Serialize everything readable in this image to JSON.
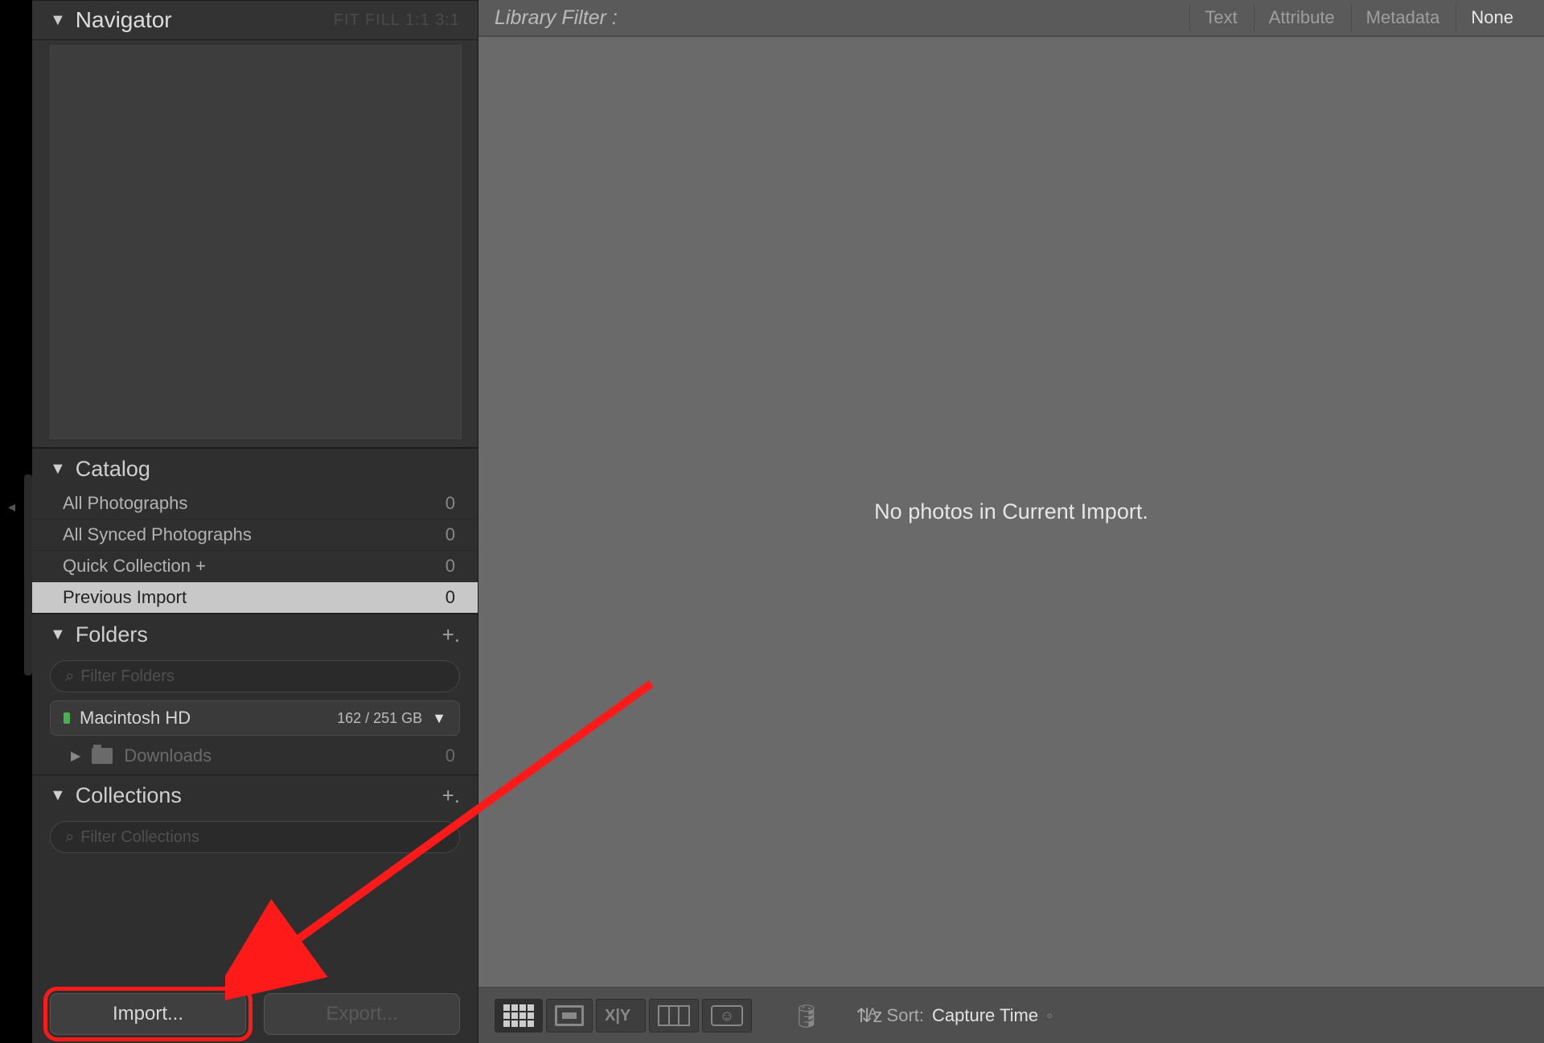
{
  "sidebar": {
    "navigator": {
      "title": "Navigator",
      "zoom_levels": "FIT  FILL   1:1   3:1"
    },
    "catalog": {
      "title": "Catalog",
      "items": [
        {
          "label": "All Photographs",
          "count": "0"
        },
        {
          "label": "All Synced Photographs",
          "count": "0"
        },
        {
          "label": "Quick Collection  +",
          "count": "0"
        },
        {
          "label": "Previous Import",
          "count": "0",
          "selected": true
        }
      ]
    },
    "folders": {
      "title": "Folders",
      "filter_placeholder": "Filter Folders",
      "volume": {
        "name": "Macintosh HD",
        "size": "162 / 251 GB"
      },
      "subfolder": {
        "label": "Downloads",
        "count": "0"
      }
    },
    "collections": {
      "title": "Collections",
      "filter_placeholder": "Filter Collections"
    },
    "buttons": {
      "import": "Import...",
      "export": "Export..."
    }
  },
  "library": {
    "filter_label": "Library Filter :",
    "tabs": {
      "text": "Text",
      "attribute": "Attribute",
      "metadata": "Metadata",
      "none": "None"
    },
    "empty_message": "No photos in Current Import."
  },
  "toolbar": {
    "sort_label": "Sort:",
    "sort_value": "Capture Time"
  }
}
